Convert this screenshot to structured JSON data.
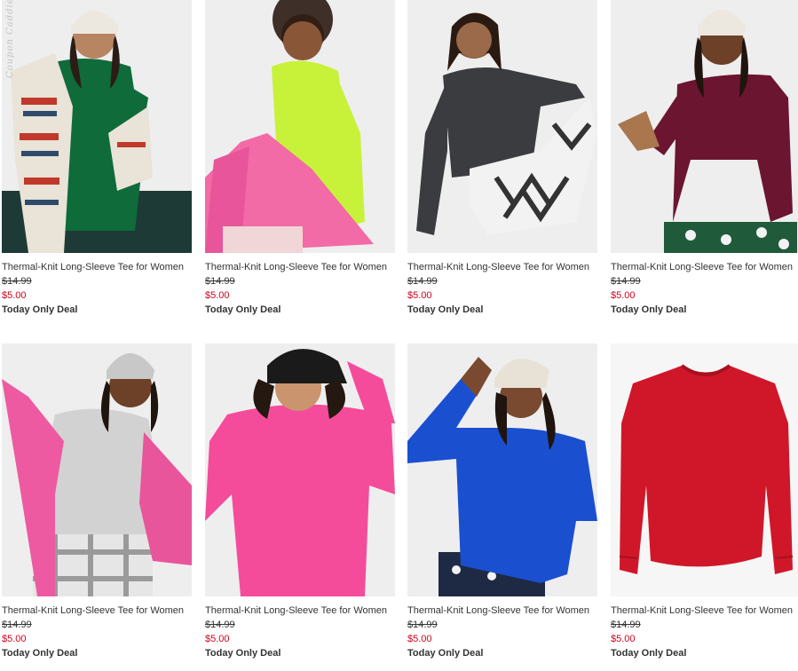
{
  "watermark": "Coupon Caddies.ca",
  "products": [
    {
      "name": "Thermal-Knit Long-Sleeve Tee for Women",
      "original_price": "$14.99",
      "sale_price": "$5.00",
      "deal": "Today Only Deal",
      "icon": "woman-green-tee-fair-isle-scarf",
      "colors": {
        "bg": "#eeeeee",
        "shirt": "#0f6b3a"
      }
    },
    {
      "name": "Thermal-Knit Long-Sleeve Tee for Women",
      "original_price": "$14.99",
      "sale_price": "$5.00",
      "deal": "Today Only Deal",
      "icon": "woman-lime-tee-pink-fleece",
      "colors": {
        "bg": "#eeeeee",
        "shirt": "#c8f23a"
      }
    },
    {
      "name": "Thermal-Knit Long-Sleeve Tee for Women",
      "original_price": "$14.99",
      "sale_price": "$5.00",
      "deal": "Today Only Deal",
      "icon": "woman-charcoal-tee-patterned-pants",
      "colors": {
        "bg": "#eeeeee",
        "shirt": "#3b3c40"
      }
    },
    {
      "name": "Thermal-Knit Long-Sleeve Tee for Women",
      "original_price": "$14.99",
      "sale_price": "$5.00",
      "deal": "Today Only Deal",
      "icon": "woman-burgundy-tee-beanie",
      "colors": {
        "bg": "#eeeeee",
        "shirt": "#6b1530"
      }
    },
    {
      "name": "Thermal-Knit Long-Sleeve Tee for Women",
      "original_price": "$14.99",
      "sale_price": "$5.00",
      "deal": "Today Only Deal",
      "icon": "woman-heather-gray-tee-pink-fleece",
      "colors": {
        "bg": "#eeeeee",
        "shirt": "#d2d2d2"
      }
    },
    {
      "name": "Thermal-Knit Long-Sleeve Tee for Women",
      "original_price": "$14.99",
      "sale_price": "$5.00",
      "deal": "Today Only Deal",
      "icon": "woman-pink-tee-black-beanie",
      "colors": {
        "bg": "#eeeeee",
        "shirt": "#f44c9a"
      }
    },
    {
      "name": "Thermal-Knit Long-Sleeve Tee for Women",
      "original_price": "$14.99",
      "sale_price": "$5.00",
      "deal": "Today Only Deal",
      "icon": "woman-blue-tee-cream-beanie",
      "colors": {
        "bg": "#eeeeee",
        "shirt": "#1a4fd0"
      }
    },
    {
      "name": "Thermal-Knit Long-Sleeve Tee for Women",
      "original_price": "$14.99",
      "sale_price": "$5.00",
      "deal": "Today Only Deal",
      "icon": "red-tee-flat-lay",
      "colors": {
        "bg": "#f6f6f6",
        "shirt": "#d0172a"
      }
    }
  ]
}
